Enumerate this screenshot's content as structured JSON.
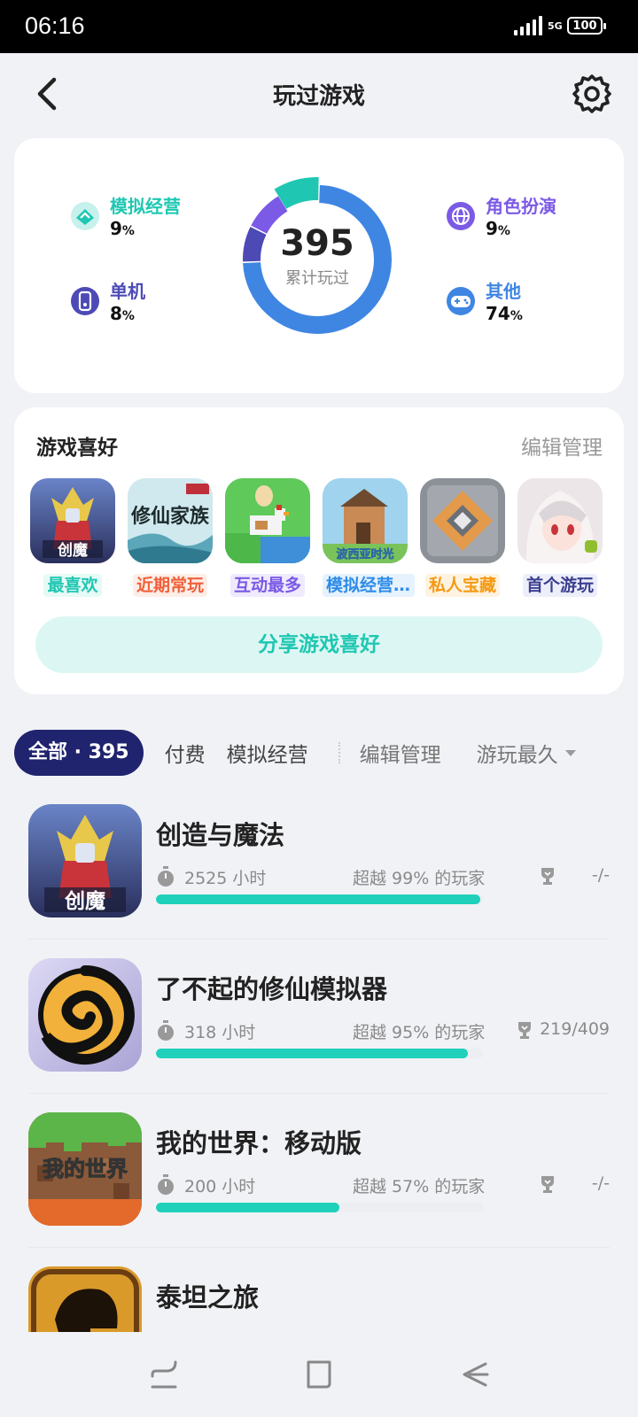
{
  "status_bar": {
    "time": "06:16",
    "network": "5G",
    "battery": "100"
  },
  "header": {
    "title": "玩过游戏",
    "back_icon": "back-arrow-icon",
    "settings_icon": "gear-icon"
  },
  "stats": {
    "total": "395",
    "total_label": "累计玩过",
    "categories": [
      {
        "name": "模拟经营",
        "percent": "9",
        "unit": "%",
        "color": "#1fc7b2",
        "icon": "leaf-badge-icon"
      },
      {
        "name": "单机",
        "percent": "8",
        "unit": "%",
        "color": "#4d4ab6",
        "icon": "phone-gamepad-icon"
      },
      {
        "name": "角色扮演",
        "percent": "9",
        "unit": "%",
        "color": "#7b5ae6",
        "icon": "globe-icon"
      },
      {
        "name": "其他",
        "percent": "74",
        "unit": "%",
        "color": "#3f86e3",
        "icon": "gamepad-icon"
      }
    ]
  },
  "preferences": {
    "title": "游戏喜好",
    "edit_label": "编辑管理",
    "items": [
      {
        "tag": "最喜欢",
        "tag_color": "#1fc7b2",
        "tag_bg": "#e6faf6",
        "icon_text": "创魔"
      },
      {
        "tag": "近期常玩",
        "tag_color": "#f0603a",
        "tag_bg": "#fdeee8",
        "icon_text": "修仙家族"
      },
      {
        "tag": "互动最多",
        "tag_color": "#7b5ae6",
        "tag_bg": "#efeafd",
        "icon_text": ""
      },
      {
        "tag": "模拟经营游戏",
        "tag_color": "#2d8ce8",
        "tag_bg": "#e6f2fd",
        "icon_text": "波西亚时光"
      },
      {
        "tag": "私人宝藏",
        "tag_color": "#f59a12",
        "tag_bg": "#fef3e1",
        "icon_text": ""
      },
      {
        "tag": "首个游玩",
        "tag_color": "#3b3f8f",
        "tag_bg": "#eceefa",
        "icon_text": ""
      }
    ],
    "share_label": "分享游戏喜好"
  },
  "filters": {
    "active": "全部 · 395",
    "tabs": [
      "付费",
      "模拟经营"
    ],
    "edit_label": "编辑管理",
    "sort_label": "游玩最久"
  },
  "games": [
    {
      "name": "创造与魔法",
      "hours": "2525 小时",
      "rank": "超越 99% 的玩家",
      "achievements": "-/-",
      "progress": 0.99,
      "icon_text": "创魔"
    },
    {
      "name": "了不起的修仙模拟器",
      "hours": "318 小时",
      "rank": "超越 95% 的玩家",
      "achievements": "219/409",
      "progress": 0.95,
      "icon_text": ""
    },
    {
      "name": "我的世界：移动版",
      "hours": "200 小时",
      "rank": "超越 57% 的玩家",
      "achievements": "-/-",
      "progress": 0.56,
      "icon_text": "我的世界"
    },
    {
      "name": "泰坦之旅",
      "hours": "",
      "rank": "",
      "achievements": "",
      "progress": 0,
      "icon_text": ""
    }
  ]
}
